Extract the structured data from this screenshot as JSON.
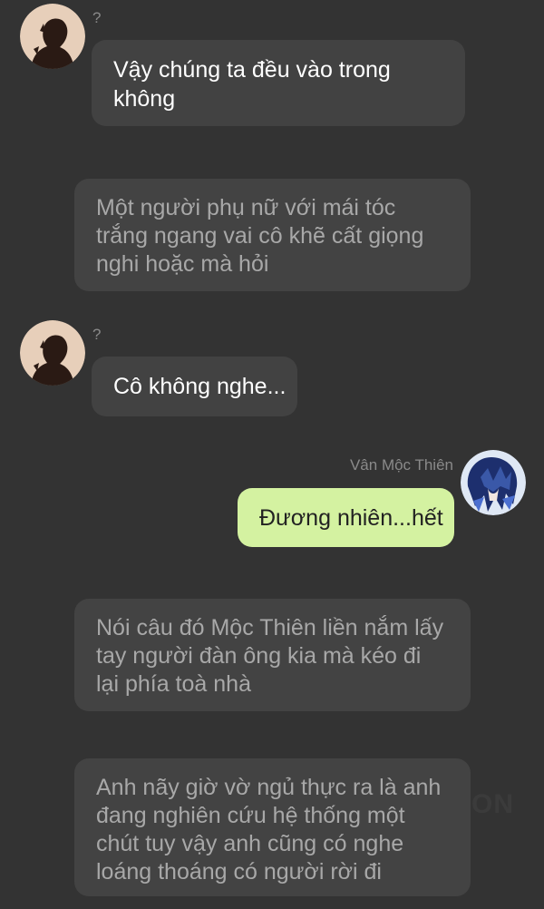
{
  "messages": [
    {
      "kind": "incoming",
      "sender": "?",
      "text": "Vậy chúng ta đều vào trong không"
    },
    {
      "kind": "narration",
      "text": "Một người phụ nữ với mái tóc trắng ngang vai cô khẽ cất giọng nghi hoặc mà hỏi"
    },
    {
      "kind": "incoming",
      "sender": "?",
      "text": "Cô không nghe..."
    },
    {
      "kind": "outgoing",
      "sender": "Vân Mộc Thiên",
      "text": "Đương nhiên...hết"
    },
    {
      "kind": "narration",
      "text": "Nói câu đó Mộc Thiên liền nắm lấy tay người đàn ông kia mà kéo đi lại phía toà nhà"
    },
    {
      "kind": "narration",
      "text": "Anh nãy giờ vờ ngủ thực ra là anh đang nghiên cứu hệ thống một chút tuy vậy anh cũng có nghe loáng thoáng có người rời đi"
    }
  ],
  "watermark": "ON",
  "colors": {
    "background": "#333333",
    "incoming_bubble": "#424242",
    "outgoing_bubble": "#d4f2a1",
    "narration_bubble": "#434343",
    "narration_text": "#a8a8a8",
    "sender_name": "#8a8a8a"
  }
}
